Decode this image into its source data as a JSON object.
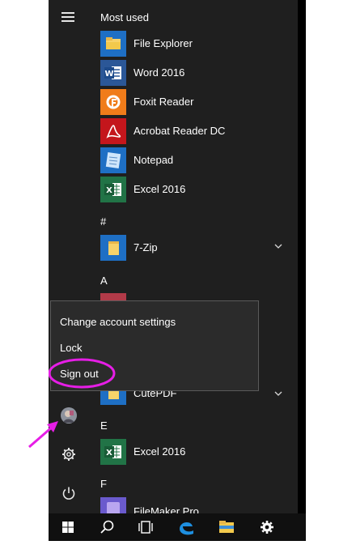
{
  "sections": {
    "most_used": "Most used",
    "hash": "#",
    "a": "A",
    "e": "E",
    "f": "F"
  },
  "apps": {
    "file_explorer": "File Explorer",
    "word": "Word 2016",
    "foxit": "Foxit Reader",
    "acrobat": "Acrobat Reader DC",
    "notepad": "Notepad",
    "excel": "Excel 2016",
    "seven_zip": "7-Zip",
    "cutepdf": "CutePDF",
    "excel_e": "Excel 2016",
    "filemaker": "FileMaker Pro"
  },
  "account_menu": {
    "change_settings": "Change account settings",
    "lock": "Lock",
    "sign_out": "Sign out"
  },
  "icons": {
    "hamburger": "menu-icon",
    "settings": "gear-icon",
    "power": "power-icon",
    "start": "windows-logo-icon",
    "search": "search-icon",
    "task_view": "task-view-icon",
    "edge": "edge-icon",
    "explorer": "folder-icon",
    "taskbar_settings": "gear-icon"
  },
  "colors": {
    "annotation": "#e61ee6",
    "menu_bg": "#1f1f1f",
    "tile_blue": "#1e6fc4",
    "word_blue": "#2b5797",
    "foxit_orange": "#f07c1a",
    "acrobat_red": "#c4161c",
    "excel_green": "#217346"
  }
}
